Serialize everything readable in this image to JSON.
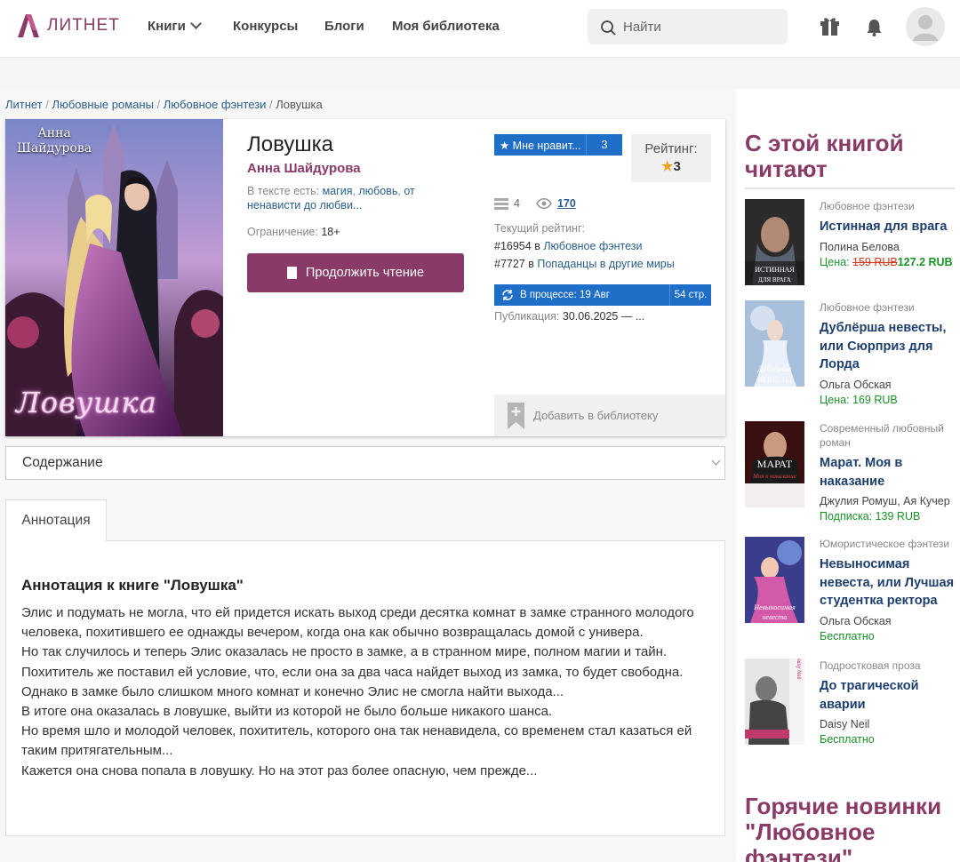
{
  "header": {
    "logo_text": "ЛИТНЕТ",
    "nav": [
      "Книги",
      "Конкурсы",
      "Блоги",
      "Моя библиотека"
    ],
    "search_placeholder": "Найти",
    "icons": [
      "gift-icon",
      "bell-icon",
      "user-avatar-icon"
    ]
  },
  "breadcrumb": [
    "Литнет",
    "Любовные романы",
    "Любовное фэнтези",
    "Ловушка"
  ],
  "book": {
    "cover_author": "Анна Шайдурова",
    "cover_title": "Ловушка",
    "title": "Ловушка",
    "author": "Анна Шайдурова",
    "tags_label": "В тексте есть:",
    "tags": [
      "магия",
      "любовь",
      "от ненависти до любви..."
    ],
    "restriction_label": "Ограничение:",
    "restriction_value": "18+",
    "read_button": "Продолжить чтение",
    "like_label": "★ Мне нравит...",
    "like_count": "3",
    "rating_label": "Рейтинг:",
    "rating_value": "3",
    "stats_chapters": "4",
    "stats_views": "170",
    "current_rating_label": "Текущий рейтинг:",
    "current_rating": [
      {
        "rank": "#16954",
        "in": "в",
        "genre": "Любовное фэнтези"
      },
      {
        "rank": "#7727",
        "in": "в",
        "genre": "Попаданцы в другие миры"
      }
    ],
    "status_label": "В процессе: 19 Авг",
    "pages": "54 стр.",
    "publication_label": "Публикация:",
    "publication_value": "30.06.2025 — ...",
    "add_library": "Добавить в библиотеку"
  },
  "contents_select": "Содержание",
  "tabs": [
    "Аннотация"
  ],
  "annotation": {
    "heading": "Аннотация к книге \"Ловушка\"",
    "paragraphs": [
      "Элис и подумать не могла, что ей придется искать выход  среди десятка комнат в замке странного молодого человека, похитившего ее однажды вечером, когда она как обычно возвращалась домой с универа.",
      "Но так случилось и теперь Элис оказалась не просто в замке, а в странном мире, полном магии и тайн.",
      "Похититель же поставил ей условие, что, если она за два часа найдет выход из замка, то будет свободна.",
      "Однако в замке было слишком много комнат и конечно Элис не смогла найти выхода...",
      "В итоге она оказалась в ловушке, выйти из которой не было больше никакого шанса.",
      "Но время шло и молодой человек, похититель, которого она так ненавидела, со временем стал казаться ей таким притягательным...",
      "Кажется она снова попала в ловушку. Но на этот раз более опасную, чем прежде..."
    ]
  },
  "sidebar": {
    "heading": "С этой книгой читают",
    "heading2": "Горячие новинки \"Любовное фэнтези\"",
    "items": [
      {
        "genre": "Любовное фэнтези",
        "title": "Истинная для врага",
        "author": "Полина Белова",
        "price_label": "Цена: ",
        "old_price": "159 RUB",
        "new_price": "127.2 RUB",
        "cover_text": "ИСТИННАЯ ДЛЯ ВРАГА",
        "cover_color": "#2b2b2b"
      },
      {
        "genre": "Любовное фэнтези",
        "title": "Дублёрша невесты, или Сюрприз для Лорда",
        "author": "Ольга Обская",
        "price": "Цена: 169 RUB",
        "cover_text": "Дублёрша НЕВЕСТЫ",
        "cover_color": "#8fa9c9"
      },
      {
        "genre": "Современный любовный роман",
        "title": "Марат. Моя в наказание",
        "author": "Джулия Ромуш, Ая Кучер",
        "price": "Подписка: 139 RUB",
        "cover_text": "МАРАТ",
        "cover_color": "#3a0f0f"
      },
      {
        "genre": "Юмористическое фэнтези",
        "title": "Невыносимая невеста, или Лучшая студентка ректора",
        "author": "Ольга Обская",
        "price": "Бесплатно",
        "cover_text": "Невыносимая невеста",
        "cover_color": "#3a3c8c"
      },
      {
        "genre": "Подростковая проза",
        "title": "До трагической аварии",
        "author": "Daisy Neil",
        "price": "Бесплатно",
        "cover_text": "Daisy Neil",
        "cover_color": "#555555"
      }
    ]
  },
  "colors": {
    "brand": "#8a3a66",
    "link": "#2a5e8c",
    "blue": "#1f6fc8",
    "price_green": "#1a9128",
    "old_price_red": "#d9381c"
  }
}
